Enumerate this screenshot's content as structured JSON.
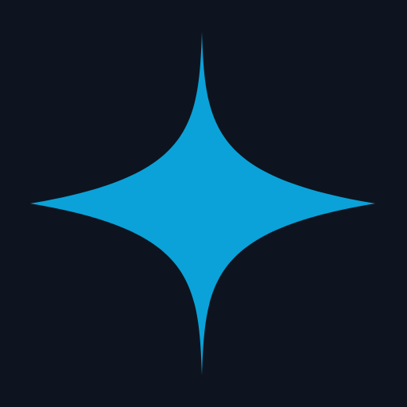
{
  "background_color": "#0e141f",
  "icon": {
    "name": "sparkle-icon",
    "shape": "four-point-star",
    "color": "#0aa2d9"
  }
}
